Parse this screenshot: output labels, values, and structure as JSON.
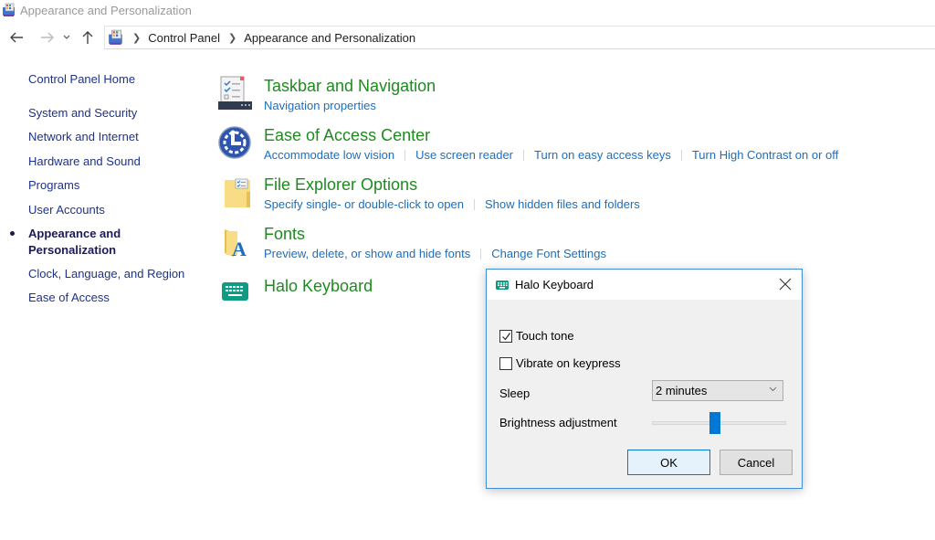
{
  "window": {
    "title": "Appearance and Personalization"
  },
  "navigation": {
    "back_icon": "back-arrow-icon",
    "forward_icon": "forward-arrow-icon",
    "recent_icon": "chevron-down-icon",
    "up_icon": "up-arrow-icon",
    "breadcrumb": [
      "Control Panel",
      "Appearance and Personalization"
    ]
  },
  "sidebar": {
    "home": "Control Panel Home",
    "items": [
      {
        "label": "System and Security",
        "active": false
      },
      {
        "label": "Network and Internet",
        "active": false
      },
      {
        "label": "Hardware and Sound",
        "active": false
      },
      {
        "label": "Programs",
        "active": false
      },
      {
        "label": "User Accounts",
        "active": false
      },
      {
        "label_line1": "Appearance and",
        "label_line2": "Personalization",
        "active": true
      },
      {
        "label": "Clock, Language, and Region",
        "active": false
      },
      {
        "label": "Ease of Access",
        "active": false
      }
    ]
  },
  "categories": [
    {
      "title": "Taskbar and Navigation",
      "icon": "taskbar-icon",
      "links": [
        "Navigation properties"
      ]
    },
    {
      "title": "Ease of Access Center",
      "icon": "ease-of-access-icon",
      "links": [
        "Accommodate low vision",
        "Use screen reader",
        "Turn on easy access keys",
        "Turn High Contrast on or off"
      ]
    },
    {
      "title": "File Explorer Options",
      "icon": "folder-options-icon",
      "links": [
        "Specify single- or double-click to open",
        "Show hidden files and folders"
      ]
    },
    {
      "title": "Fonts",
      "icon": "fonts-folder-icon",
      "links": [
        "Preview, delete, or show and hide fonts",
        "Change Font Settings"
      ]
    },
    {
      "title": "Halo Keyboard",
      "icon": "keyboard-icon",
      "links": []
    }
  ],
  "dialog": {
    "title": "Halo Keyboard",
    "touch_tone": {
      "label": "Touch tone",
      "checked": true
    },
    "vibrate": {
      "label": "Vibrate on keypress",
      "checked": false
    },
    "sleep": {
      "label": "Sleep",
      "value": "2 minutes"
    },
    "brightness": {
      "label": "Brightness adjustment",
      "value_percent": 47
    },
    "ok_label": "OK",
    "cancel_label": "Cancel"
  },
  "colors": {
    "category_title": "#1f8a1f",
    "link": "#1a6fc0",
    "sidebar_link": "#1e3287",
    "accent": "#0078d7",
    "keyboard_icon": "#109b83"
  }
}
